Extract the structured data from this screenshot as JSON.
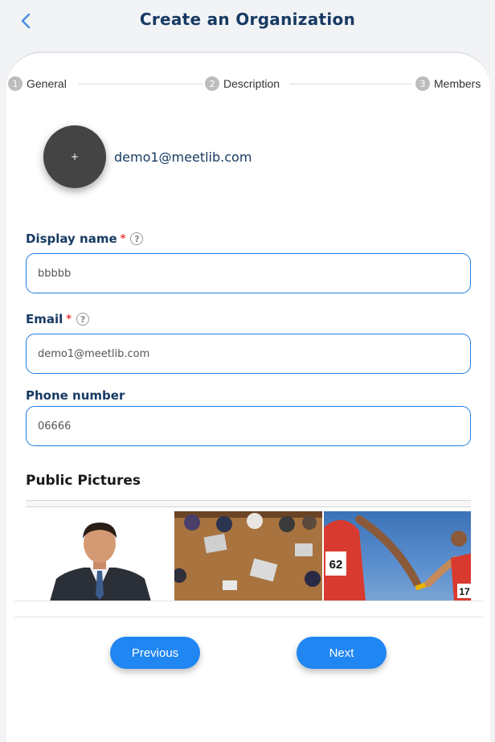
{
  "header": {
    "title": "Create an Organization",
    "back_icon": "chevron-left-icon"
  },
  "stepper": {
    "steps": [
      {
        "number": "1",
        "label": "General"
      },
      {
        "number": "2",
        "label": "Description"
      },
      {
        "number": "3",
        "label": "Members"
      }
    ]
  },
  "avatar": {
    "add_symbol": "+",
    "email": "demo1@meetlib.com"
  },
  "form": {
    "display_name": {
      "label": "Display name",
      "required_mark": "*",
      "help_symbol": "?",
      "value": "bbbbb"
    },
    "email": {
      "label": "Email",
      "required_mark": "*",
      "help_symbol": "?",
      "value": "demo1@meetlib.com"
    },
    "phone": {
      "label": "Phone number",
      "value": "06666"
    }
  },
  "pictures": {
    "title": "Public Pictures",
    "items": [
      {
        "subject": "businessman portrait"
      },
      {
        "subject": "team meeting at table"
      },
      {
        "subject": "relay race baton pass",
        "bib_left": "62",
        "bib_right": "17"
      }
    ]
  },
  "footer": {
    "previous_label": "Previous",
    "next_label": "Next"
  },
  "colors": {
    "accent": "#1f86f2",
    "title": "#173a63",
    "required": "#e53935",
    "input_border": "#1e7fe0"
  }
}
